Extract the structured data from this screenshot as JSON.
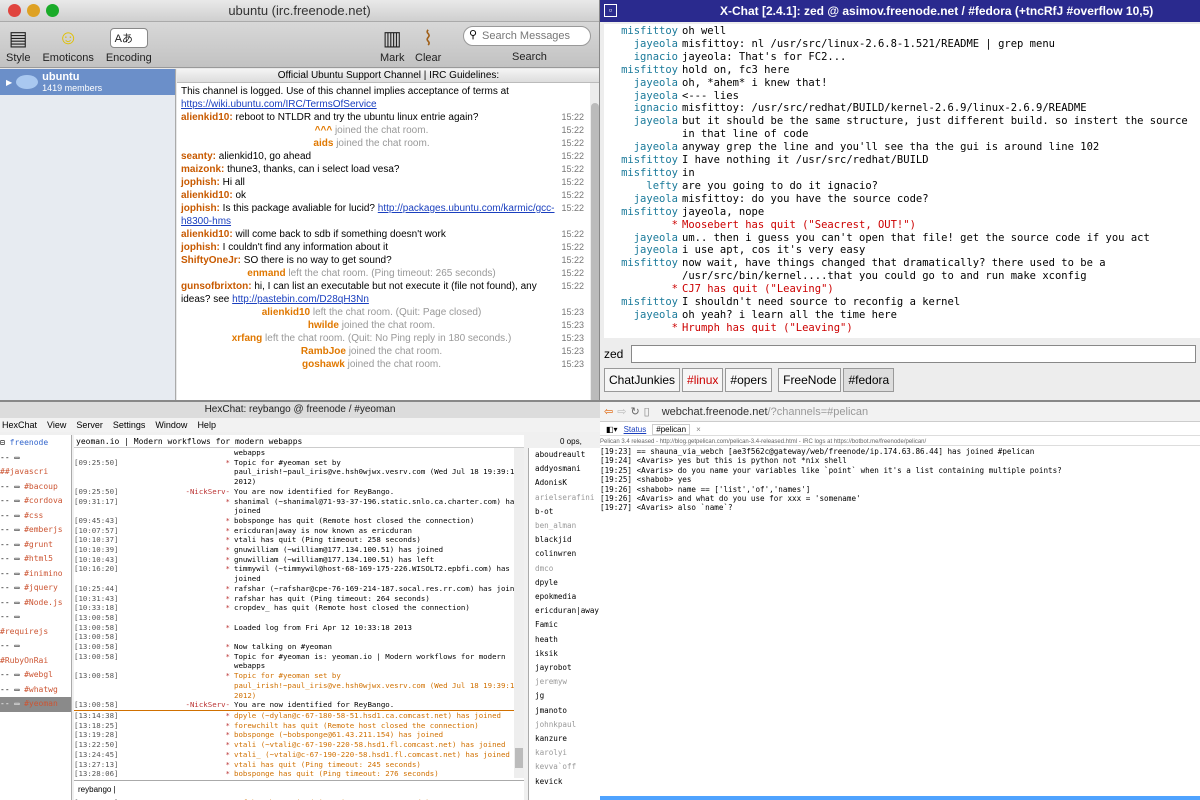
{
  "q1": {
    "title": "ubuntu (irc.freenode.net)",
    "toolbar": {
      "style": "Style",
      "emoticons": "Emoticons",
      "encoding": "Encoding",
      "encoding_value": "Aあ",
      "mark": "Mark",
      "clear": "Clear",
      "search_placeholder": "Search Messages",
      "search": "Search"
    },
    "room": {
      "name": "ubuntu",
      "members": "1419 members"
    },
    "topic": "Official Ubuntu Support Channel | IRC Guidelines:",
    "messages": [
      {
        "nick": "",
        "text": "This channel is logged. Use of this channel implies acceptance of terms at",
        "time": ""
      },
      {
        "nick": "",
        "link": "https://wiki.ubuntu.com/IRC/TermsOfService",
        "time": ""
      },
      {
        "nick": "alienkid10:",
        "text": "reboot to NTLDR and try the ubuntu linux entrie again?",
        "time": "15:22"
      },
      {
        "join": "^^^",
        "text": "joined the chat room.",
        "time": "15:22"
      },
      {
        "join": "aids",
        "text": "joined the chat room.",
        "time": "15:22"
      },
      {
        "nick": "seanty:",
        "text": "alienkid10, go ahead",
        "time": "15:22"
      },
      {
        "nick": "maizonk:",
        "text": "thune3, thanks, can i select load vesa?",
        "time": "15:22"
      },
      {
        "nick": "jophish:",
        "text": "Hi all",
        "time": "15:22"
      },
      {
        "nick": "alienkid10:",
        "text": "ok",
        "time": "15:22"
      },
      {
        "nick": "jophish:",
        "text": "Is this package avaliable for lucid?",
        "link": "http://packages.ubuntu.com/karmic/gcc-h8300-hms",
        "time": "15:22"
      },
      {
        "nick": "alienkid10:",
        "text": "will come back to sdb if something doesn't work",
        "time": "15:22"
      },
      {
        "nick": "jophish:",
        "text": "I couldn't find any information about it",
        "time": "15:22"
      },
      {
        "nick": "ShiftyOneJr:",
        "text": "SO there is no way to get sound?",
        "time": "15:22"
      },
      {
        "join": "enmand",
        "text": "left the chat room. (Ping timeout: 265 seconds)",
        "time": "15:22"
      },
      {
        "nick": "gunsofbrixton:",
        "text": "hi, I can list an executable but not execute it (file not found), any ideas? see",
        "link": "http://pastebin.com/D28qH3Nn",
        "time": "15:22"
      },
      {
        "join": "alienkid10",
        "text": "left the chat room. (Quit: Page closed)",
        "time": "15:23"
      },
      {
        "join": "hwilde",
        "text": "joined the chat room.",
        "time": "15:23"
      },
      {
        "join": "xrfang",
        "text": "left the chat room. (Quit: No Ping reply in 180 seconds.)",
        "time": "15:23"
      },
      {
        "join": "RambJoe",
        "text": "joined the chat room.",
        "time": "15:23"
      },
      {
        "join": "goshawk",
        "text": "joined the chat room.",
        "time": "15:23"
      }
    ]
  },
  "q2": {
    "title": "X-Chat [2.4.1]: zed @ asimov.freenode.net / #fedora (+tncRfJ #overflow 10,5)",
    "lines": [
      {
        "who": "misfittoy",
        "text": "oh well"
      },
      {
        "who": "jayeola",
        "text": "misfittoy: nl /usr/src/linux-2.6.8-1.521/README | grep menu"
      },
      {
        "who": "ignacio",
        "text": "jayeola: That's for FC2..."
      },
      {
        "who": "misfittoy",
        "text": "hold on, fc3 here"
      },
      {
        "who": "jayeola",
        "text": "oh, *ahem* i knew that!"
      },
      {
        "who": "jayeola",
        "text": "<--- lies"
      },
      {
        "who": "ignacio",
        "text": "misfittoy: /usr/src/redhat/BUILD/kernel-2.6.9/linux-2.6.9/README"
      },
      {
        "who": "jayeola",
        "text": "but it should be the same structure, just different build. so instert the source in that line of code"
      },
      {
        "who": "jayeola",
        "text": "anyway grep the line and you'll see tha the gui is around line 102"
      },
      {
        "who": "misfittoy",
        "text": "I have nothing it /usr/src/redhat/BUILD"
      },
      {
        "who": "misfittoy",
        "text": "in"
      },
      {
        "who": "lefty",
        "text": "are you going to do it ignacio?"
      },
      {
        "who": "jayeola",
        "text": "misfittoy: do you have the source code?"
      },
      {
        "who": "misfittoy",
        "text": "jayeola, nope"
      },
      {
        "who": "*",
        "text": "Moosebert has quit (\"Seacrest, OUT!\")",
        "quit": true
      },
      {
        "who": "jayeola",
        "text": "um.. then i guess you can't open that file! get the source code if you act"
      },
      {
        "who": "jayeola",
        "text": "i use apt, cos it's very easy"
      },
      {
        "who": "misfittoy",
        "text": "now wait, have things changed that dramatically? there used to be a /usr/src/bin/kernel....that you could go to and run make xconfig"
      },
      {
        "who": "*",
        "text": "CJ7 has quit (\"Leaving\")",
        "quit": true
      },
      {
        "who": "misfittoy",
        "text": "I shouldn't need source to reconfig a kernel"
      },
      {
        "who": "jayeola",
        "text": "oh yeah? i learn all the time here"
      },
      {
        "who": "*",
        "text": "Hrumph has quit (\"Leaving\")",
        "quit": true
      }
    ],
    "nick": "zed",
    "tabs": [
      "ChatJunkies",
      "#linux",
      "#opers",
      "FreeNode",
      "#fedora"
    ]
  },
  "q3": {
    "title": "HexChat: reybango @ freenode / #yeoman",
    "menu": [
      "HexChat",
      "View",
      "Server",
      "Settings",
      "Window",
      "Help"
    ],
    "tree": [
      "freenode",
      "##javascri",
      "#bacoup",
      "#cordova",
      "#css",
      "#emberjs",
      "#grunt",
      "#html5",
      "#inimino",
      "#jquery",
      "#Node.js",
      "#requirejs",
      "#RubyOnRai",
      "#webgl",
      "#whatwg",
      "#yeoman"
    ],
    "topic": "yeoman.io | Modern workflows for modern webapps",
    "ops": "0 ops,",
    "lines": [
      {
        "ts": "",
        "nick": "",
        "msg": "webapps"
      },
      {
        "ts": "[09:25:50]",
        "nick": "*",
        "msg": "Topic for #yeoman set by paul_irish!~paul_iris@ve.hsh0wjwx.vesrv.com (Wed Jul 18 19:39:13 2012)"
      },
      {
        "ts": "[09:25:50]",
        "nick": "-NickServ-",
        "msg": "You are now identified for ReyBango."
      },
      {
        "ts": "[09:31:17]",
        "nick": "*",
        "msg": "shanimal (~shanimal@71-93-37-196.static.snlo.ca.charter.com) has joined"
      },
      {
        "ts": "[09:45:43]",
        "nick": "*",
        "msg": "bobsponge has quit (Remote host closed the connection)"
      },
      {
        "ts": "[10:07:57]",
        "nick": "*",
        "msg": "ericduran|away is now known as ericduran"
      },
      {
        "ts": "[10:10:37]",
        "nick": "*",
        "msg": "vtali has quit (Ping timeout: 258 seconds)"
      },
      {
        "ts": "[10:10:39]",
        "nick": "*",
        "msg": "gnuwilliam (~william@177.134.100.51) has joined"
      },
      {
        "ts": "[10:10:43]",
        "nick": "*",
        "msg": "gnuwilliam (~william@177.134.100.51) has left"
      },
      {
        "ts": "[10:16:20]",
        "nick": "*",
        "msg": "timmywil (~timmywil@host-68-169-175-226.WISOLT2.epbfi.com) has joined"
      },
      {
        "ts": "[10:25:44]",
        "nick": "*",
        "msg": "rafshar (~rafshar@cpe-76-169-214-187.socal.res.rr.com) has joined"
      },
      {
        "ts": "[10:31:43]",
        "nick": "*",
        "msg": "rafshar has quit (Ping timeout: 264 seconds)"
      },
      {
        "ts": "[10:33:18]",
        "nick": "*",
        "msg": "cropdev_ has quit (Remote host closed the connection)"
      },
      {
        "ts": "[13:00:58]",
        "nick": "",
        "msg": ""
      },
      {
        "ts": "[13:00:58]",
        "nick": "*",
        "msg": "Loaded log from Fri Apr 12 10:33:18 2013"
      },
      {
        "ts": "[13:00:58]",
        "nick": "",
        "msg": ""
      },
      {
        "ts": "[13:00:58]",
        "nick": "*",
        "msg": "Now talking on #yeoman"
      },
      {
        "ts": "[13:00:58]",
        "nick": "*",
        "msg": "Topic for #yeoman is: yeoman.io | Modern workflows for modern webapps"
      },
      {
        "ts": "[13:00:58]",
        "nick": "*",
        "msg": "Topic for #yeoman set by paul_irish!~paul_iris@ve.hsh0wjwx.vesrv.com (Wed Jul 18 19:39:13 2012)",
        "or": true
      },
      {
        "ts": "[13:00:58]",
        "nick": "-NickServ-",
        "msg": "You are now identified for ReyBango."
      },
      {
        "ts": "[13:14:38]",
        "nick": "*",
        "msg": "dpyle (~dylan@c-67-180-58-51.hsd1.ca.comcast.net) has joined",
        "or": true
      },
      {
        "ts": "[13:18:25]",
        "nick": "*",
        "msg": "forewchilt has quit (Remote host closed the connection)",
        "or": true
      },
      {
        "ts": "[13:19:28]",
        "nick": "*",
        "msg": "bobsponge (~bobsponge@61.43.211.154) has joined",
        "or": true
      },
      {
        "ts": "[13:22:50]",
        "nick": "*",
        "msg": "vtali (~vtali@c-67-190-220-58.hsd1.fl.comcast.net) has joined",
        "or": true
      },
      {
        "ts": "[13:24:45]",
        "nick": "*",
        "msg": "vtali_ (~vtali@c-67-190-220-58.hsd1.fl.comcast.net) has joined",
        "or": true
      },
      {
        "ts": "[13:27:13]",
        "nick": "*",
        "msg": "vtali has quit (Ping timeout: 245 seconds)",
        "or": true
      },
      {
        "ts": "[13:28:06]",
        "nick": "*",
        "msg": "bobsponge has quit (Ping timeout: 276 seconds)",
        "or": true
      },
      {
        "ts": "[13:31:14]",
        "nick": "*",
        "msg": "kevva is now known as kevva`off"
      },
      {
        "ts": "[13:33:22]",
        "nick": "*",
        "msg": "rafshar (~rafshar@cpe-76-169-214-187.socal.res.rr.com) has joined",
        "or": true
      },
      {
        "ts": "[13:37:55]",
        "nick": "*",
        "msg": "rafshar has quit (Ping timeout: 245 seconds)",
        "or": true
      }
    ],
    "users": [
      "aboudreault",
      "addyosmani",
      "AdonisK",
      "arielserafini",
      "b-ot",
      "ben_alman",
      "blackjid",
      "colinwren",
      "dmco",
      "dpyle",
      "epokmedia",
      "ericduran|away",
      "Famic",
      "heath",
      "iksik",
      "jayrobot",
      "jeremyw",
      "jg",
      "jmanoto",
      "johnkpaul",
      "kanzure",
      "karolyi",
      "kevva`off",
      "kevick"
    ],
    "input_nick": "reybango"
  },
  "q4": {
    "url_prefix": "webchat.freenode.net",
    "url_rest": "/?channels=#pelican",
    "tab_status": "Status",
    "tab_channel": "#pelican",
    "banner": "Pelican 3.4 released - http://blog.getpelican.com/pelican-3.4-released.html - IRC logs at https://botbot.me/freenode/pelican/",
    "lines": [
      "[19:23] == shauna_via_webch [ae3f562c@gateway/web/freenode/ip.174.63.86.44] has joined #pelican",
      "[19:24] <Avaris> yes but this is python not *nix shell",
      "[19:25] <Avaris> do you name your variables like `point` when it's a list containing multiple points?",
      "[19:25] <shabob> yes",
      "[19:26] <shabob> name == ['list','of','names']",
      "[19:26] <Avaris> and what do you use for xxx = 'somename'",
      "[19:27] <Avaris> also `name`?"
    ]
  }
}
